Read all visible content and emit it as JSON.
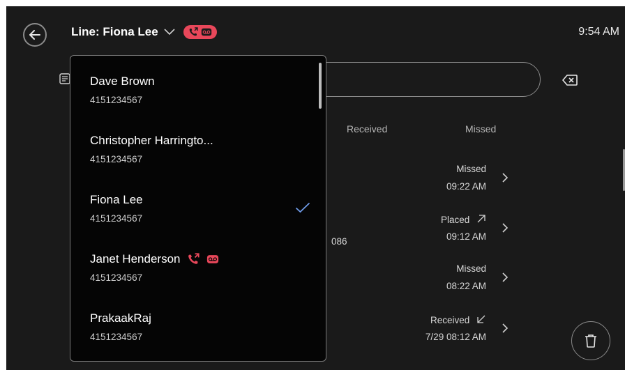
{
  "header": {
    "line_label": "Line: Fiona Lee",
    "time": "9:54 AM",
    "icons": [
      "back-arrow-icon",
      "chevron-down-icon",
      "call-forward-icon",
      "voicemail-icon"
    ]
  },
  "tabs": [
    {
      "label": "Received"
    },
    {
      "label": "Missed"
    }
  ],
  "calls": [
    {
      "status": "Missed",
      "time": "09:22 AM",
      "icon": ""
    },
    {
      "status": "Placed",
      "time": "09:12 AM",
      "icon": "outgoing-arrow-icon"
    },
    {
      "status": "Missed",
      "time": "08:22 AM",
      "icon": ""
    },
    {
      "status": "Received",
      "time": "7/29 08:12 AM",
      "icon": "incoming-arrow-icon"
    }
  ],
  "partial_number": "086",
  "line_menu": {
    "items": [
      {
        "name": "Dave Brown",
        "number": "4151234567",
        "selected": false
      },
      {
        "name": "Christopher Harringto...",
        "number": "4151234567",
        "selected": false
      },
      {
        "name": "Fiona Lee",
        "number": "4151234567",
        "selected": true
      },
      {
        "name": "Janet Henderson",
        "number": "4151234567",
        "selected": false,
        "icons": [
          "call-forward-icon",
          "voicemail-icon"
        ]
      },
      {
        "name": "PrakaakRaj",
        "number": "4151234567",
        "selected": false
      }
    ]
  },
  "colors": {
    "background": "#1a1a1a",
    "menu_background": "#050505",
    "accent_red": "#e8475a",
    "check_blue": "#6f9be8"
  }
}
